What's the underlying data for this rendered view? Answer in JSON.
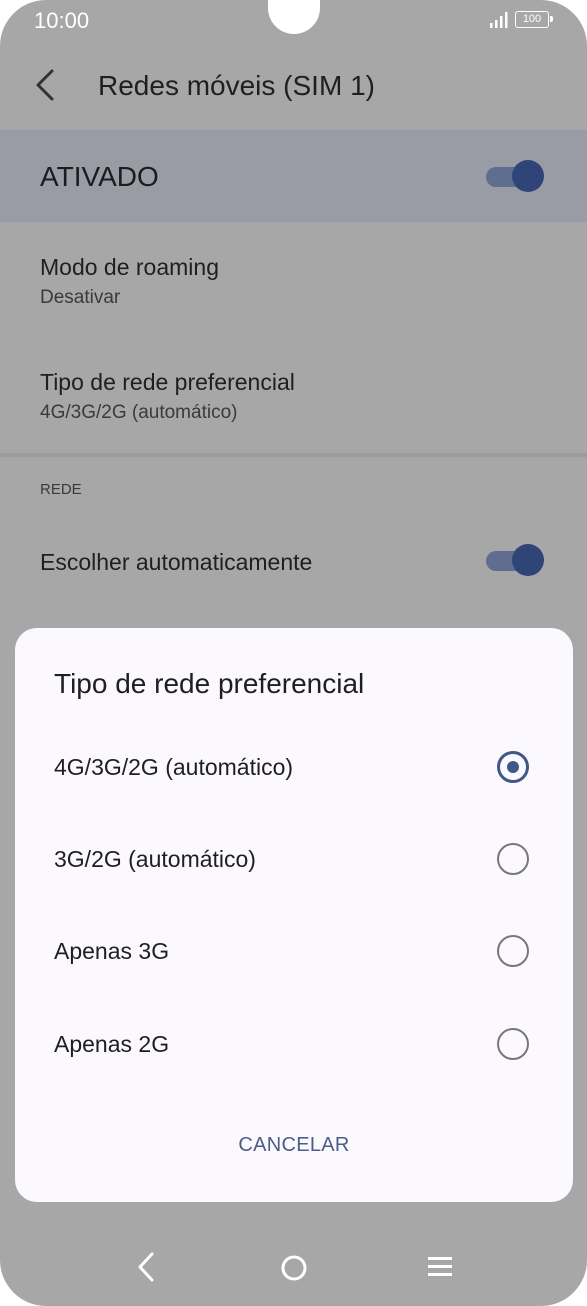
{
  "status_bar": {
    "time": "10:00",
    "battery": "100"
  },
  "app_bar": {
    "title": "Redes móveis (SIM 1)"
  },
  "master_switch": {
    "label": "ATIVADO",
    "on": true
  },
  "settings": [
    {
      "title": "Modo de roaming",
      "subtitle": "Desativar"
    },
    {
      "title": "Tipo de rede preferencial",
      "subtitle": "4G/3G/2G (automático)"
    }
  ],
  "network_section": {
    "header": "REDE",
    "auto_select": {
      "label": "Escolher automaticamente",
      "on": true
    }
  },
  "dialog": {
    "title": "Tipo de rede preferencial",
    "options": [
      {
        "label": "4G/3G/2G (automático)",
        "selected": true
      },
      {
        "label": "3G/2G (automático)",
        "selected": false
      },
      {
        "label": "Apenas 3G",
        "selected": false
      },
      {
        "label": "Apenas 2G",
        "selected": false
      }
    ],
    "cancel_label": "CANCELAR"
  },
  "colors": {
    "accent": "#3e5888",
    "scrim": "#a7a7a7",
    "dialog_bg": "#fbf9fd"
  }
}
